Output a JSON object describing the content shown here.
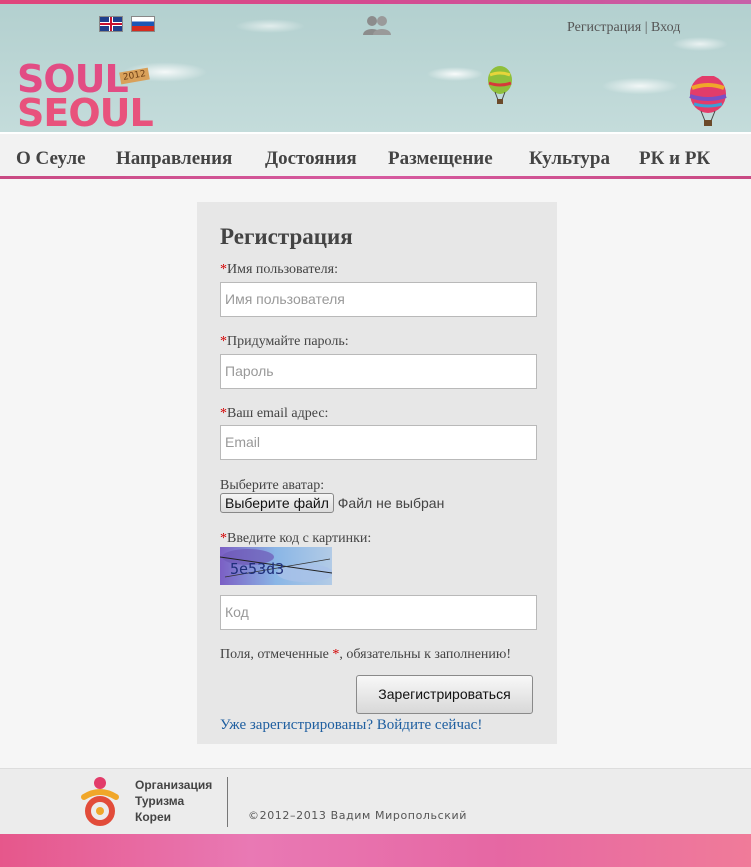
{
  "header": {
    "languages": [
      {
        "code": "en",
        "icon": "uk-flag-icon"
      },
      {
        "code": "ru",
        "icon": "russia-flag-icon"
      }
    ],
    "users_icon": "users-icon",
    "register_link": "Регистрация",
    "separator": "|",
    "login_link": "Вход",
    "logo_line1": "SOUL",
    "logo_line2": "SEOUL",
    "logo_tag": "2012"
  },
  "nav": {
    "items": [
      {
        "label": "О Сеуле"
      },
      {
        "label": "Направления"
      },
      {
        "label": "Достояния"
      },
      {
        "label": "Размещение"
      },
      {
        "label": "Культура"
      },
      {
        "label": "РК и РК"
      }
    ]
  },
  "form": {
    "title": "Регистрация",
    "required_mark": "*",
    "username_label": "Имя пользователя:",
    "username_placeholder": "Имя пользователя",
    "password_label": "Придумайте пароль:",
    "password_placeholder": "Пароль",
    "email_label": "Ваш email адрес:",
    "email_placeholder": "Email",
    "avatar_label": "Выберите аватар:",
    "file_button": "Выберите файл",
    "file_status": "Файл не выбран",
    "captcha_label": "Введите код с картинки:",
    "captcha_text": "5e53d3",
    "code_placeholder": "Код",
    "note_before": "Поля, отмеченные ",
    "note_after": ", обязательны к заполнению!",
    "submit_label": "Зарегистрироваться",
    "login_link": "Уже зарегистрированы? Войдите сейчас!"
  },
  "footer": {
    "org_line1": "Организация",
    "org_line2": "Туризма",
    "org_line3": "Кореи",
    "copyright": "©2012–2013 Вадим Миропольский"
  }
}
